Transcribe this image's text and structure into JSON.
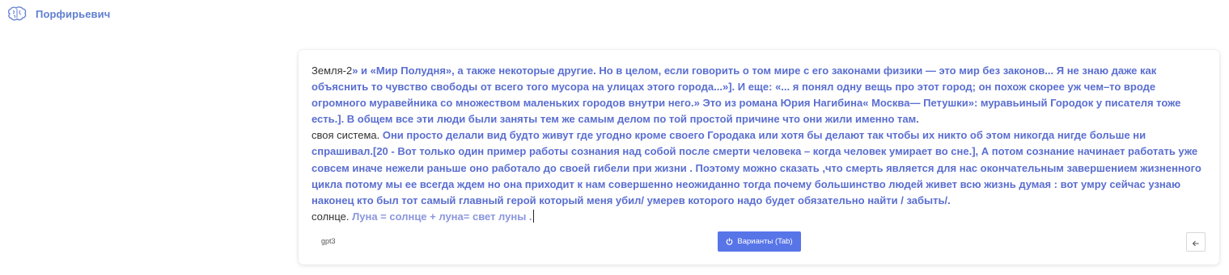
{
  "header": {
    "brand": "Порфирьевич",
    "logo_icon": "brain-icon",
    "accent_color": "#5f7fd1"
  },
  "editor": {
    "paragraphs": [
      {
        "user": "Земля-2",
        "generated": "» и «Мир Полудня», а также некоторые другие. Но в целом, если говорить о том мире с его законами физики — это мир без законов... Я не знаю даже как объяснить то чувство свободы от всего того мусора на улицах этого города...»]. И еще: «... я понял одну вещь про этот город; он похож скорее уж чем–то вроде огромного муравейника со множеством маленьких городов внутри него.» Это из романа Юрия Нагибина« Москва— Петушки»: муравьиный Городок у писателя тоже есть.]. В общем все эти люди были заняты тем же самым делом по той простой причине что они жили именно там."
      },
      {
        "user": "своя система.",
        "generated": " Они просто делали вид будто живут где угодно кроме своего Городака или хотя бы делают так чтобы их никто об этом никогда нигде больше ни спрашивал.[20 - Вот только один пример работы сознания над собой после смерти человека – когда человек умирает во сне.], А потом сознание начинает работать уже совсем иначе нежели раньше оно работало до своей гибели при жизни . Поэтому можно сказать ,что смерть является для нас окончательным завершением жизненного цикла потому мы ее всегда ждем но она приходит к нам совершенно неожиданно тогда почему большинство людей живет всю жизнь думая : вот умру сейчас узнаю наконец кто был тот самый главный герой который меня убил/ умерев которого надо будет обязательно найти / забыть/."
      },
      {
        "user": "солнце.",
        "generated": " Луна = солнце + луна= свет луны ."
      }
    ],
    "user_text_color": "#333333",
    "generated_text_color": "#5a6ed0",
    "latest_generated_color": "#8a96de"
  },
  "footer": {
    "model": "gpt3",
    "variants_label": "Варианты (Tab)",
    "variants_icon": "power-icon",
    "variants_color": "#5875e8",
    "back_icon": "arrow-left-icon"
  }
}
